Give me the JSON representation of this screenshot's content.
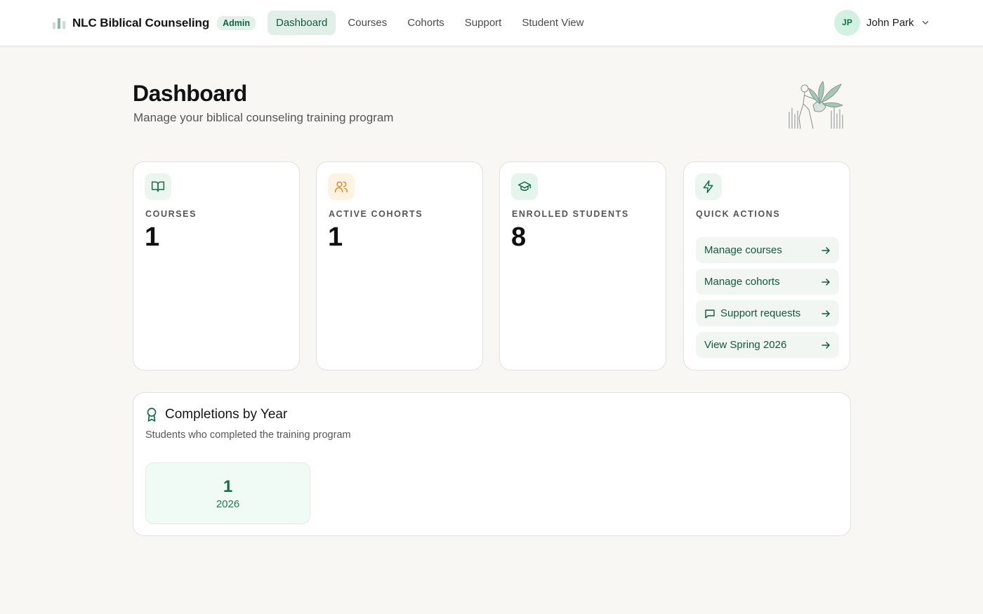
{
  "header": {
    "brand_name": "NLC Biblical Counseling",
    "badge": "Admin",
    "nav": [
      {
        "label": "Dashboard",
        "active": true
      },
      {
        "label": "Courses",
        "active": false
      },
      {
        "label": "Cohorts",
        "active": false
      },
      {
        "label": "Support",
        "active": false
      },
      {
        "label": "Student View",
        "active": false
      }
    ],
    "user": {
      "initials": "JP",
      "name": "John Park"
    }
  },
  "page": {
    "title": "Dashboard",
    "subtitle": "Manage your biblical counseling training program"
  },
  "stats": [
    {
      "label": "COURSES",
      "value": "1",
      "icon": "book-open-icon"
    },
    {
      "label": "ACTIVE COHORTS",
      "value": "1",
      "icon": "users-icon"
    },
    {
      "label": "ENROLLED STUDENTS",
      "value": "8",
      "icon": "graduation-cap-icon"
    }
  ],
  "quick_actions": {
    "label": "QUICK ACTIONS",
    "icon": "lightning-icon",
    "items": [
      {
        "label": "Manage courses"
      },
      {
        "label": "Manage cohorts"
      },
      {
        "label": "Support requests",
        "icon": "message-square-icon"
      },
      {
        "label": "View Spring 2026"
      }
    ]
  },
  "completions": {
    "title": "Completions by Year",
    "subtitle": "Students who completed the training program",
    "icon": "award-icon",
    "years": [
      {
        "count": "1",
        "year": "2026"
      }
    ]
  },
  "colors": {
    "accent": "#15573f",
    "accent_light": "#e2efe8",
    "background": "#f8f7f4",
    "warm_icon": "#d98a2b"
  }
}
